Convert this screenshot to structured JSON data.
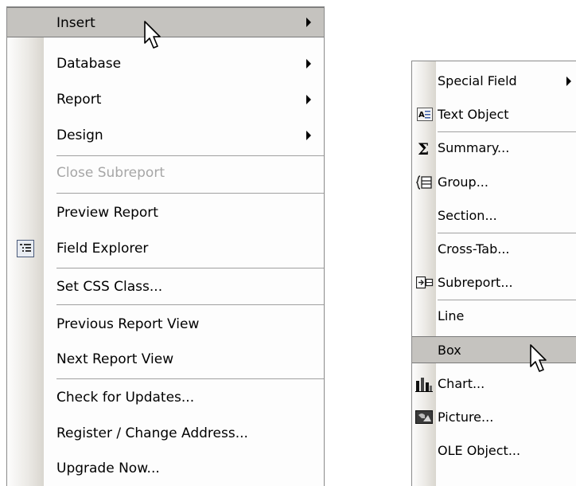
{
  "main_menu": {
    "items": [
      {
        "label": "Insert",
        "has_submenu": true,
        "highlighted": true
      },
      {
        "label": "Database",
        "has_submenu": true
      },
      {
        "label": "Report",
        "has_submenu": true
      },
      {
        "label": "Design",
        "has_submenu": true
      },
      {
        "label": "Close Subreport",
        "disabled": true
      },
      {
        "label": "Preview Report"
      },
      {
        "label": "Field Explorer",
        "icon": "field-explorer-icon"
      },
      {
        "label": "Set CSS Class..."
      },
      {
        "label": "Previous Report View"
      },
      {
        "label": "Next Report View"
      },
      {
        "label": "Check for Updates..."
      },
      {
        "label": "Register / Change Address..."
      },
      {
        "label": "Upgrade Now..."
      }
    ]
  },
  "insert_submenu": {
    "items": [
      {
        "label": "Special Field",
        "has_submenu": true
      },
      {
        "label": "Text Object",
        "icon": "text-object-icon"
      },
      {
        "label": "Summary...",
        "icon": "sigma-icon"
      },
      {
        "label": "Group...",
        "icon": "group-icon"
      },
      {
        "label": "Section..."
      },
      {
        "label": "Cross-Tab..."
      },
      {
        "label": "Subreport...",
        "icon": "subreport-icon"
      },
      {
        "label": "Line"
      },
      {
        "label": "Box",
        "highlighted": true
      },
      {
        "label": "Chart...",
        "icon": "chart-icon"
      },
      {
        "label": "Picture...",
        "icon": "picture-icon"
      },
      {
        "label": "OLE Object..."
      }
    ]
  },
  "colors": {
    "highlight": "#c5c3bf",
    "disabled_text": "#a6a6a6",
    "separator": "#a0a0a0"
  }
}
